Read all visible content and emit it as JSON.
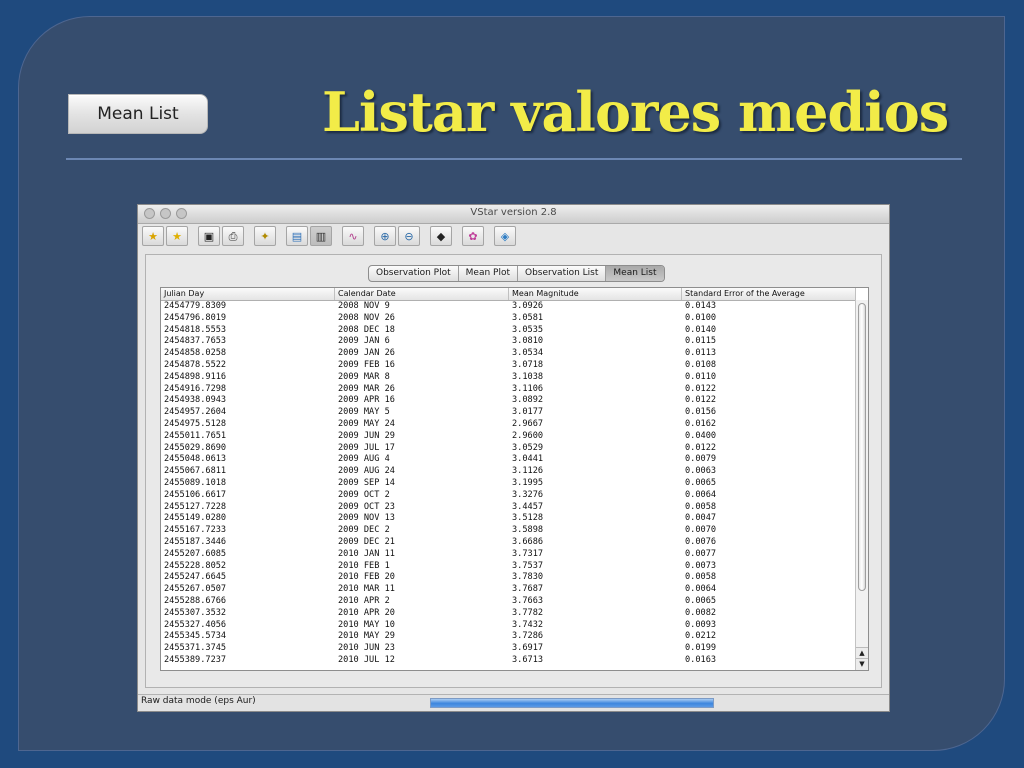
{
  "slide": {
    "button_label": "Mean List",
    "title": "Listar valores medios"
  },
  "window": {
    "title": "VStar version 2.8",
    "toolbar_icons": [
      "new-star-file-icon",
      "new-star-db-icon",
      "save-icon",
      "print-icon",
      "info-icon",
      "plot-icon",
      "mean-plot-icon",
      "phase-plot-icon",
      "zoom-in-icon",
      "zoom-out-icon",
      "filter-icon",
      "model-icon",
      "help-icon"
    ],
    "tabs": [
      "Observation Plot",
      "Mean Plot",
      "Observation List",
      "Mean List"
    ],
    "selected_tab": "Mean List",
    "columns": [
      "Julian Day",
      "Calendar Date",
      "Mean Magnitude",
      "Standard Error of the Average"
    ],
    "rows": [
      [
        "2454779.8309",
        "2008 NOV 9",
        "3.0926",
        "0.0143"
      ],
      [
        "2454796.8019",
        "2008 NOV 26",
        "3.0581",
        "0.0100"
      ],
      [
        "2454818.5553",
        "2008 DEC 18",
        "3.0535",
        "0.0140"
      ],
      [
        "2454837.7653",
        "2009 JAN 6",
        "3.0810",
        "0.0115"
      ],
      [
        "2454858.0258",
        "2009 JAN 26",
        "3.0534",
        "0.0113"
      ],
      [
        "2454878.5522",
        "2009 FEB 16",
        "3.0718",
        "0.0108"
      ],
      [
        "2454898.9116",
        "2009 MAR 8",
        "3.1038",
        "0.0110"
      ],
      [
        "2454916.7298",
        "2009 MAR 26",
        "3.1106",
        "0.0122"
      ],
      [
        "2454938.0943",
        "2009 APR 16",
        "3.0892",
        "0.0122"
      ],
      [
        "2454957.2604",
        "2009 MAY 5",
        "3.0177",
        "0.0156"
      ],
      [
        "2454975.5128",
        "2009 MAY 24",
        "2.9667",
        "0.0162"
      ],
      [
        "2455011.7651",
        "2009 JUN 29",
        "2.9600",
        "0.0400"
      ],
      [
        "2455029.8690",
        "2009 JUL 17",
        "3.0529",
        "0.0122"
      ],
      [
        "2455048.0613",
        "2009 AUG 4",
        "3.0441",
        "0.0079"
      ],
      [
        "2455067.6811",
        "2009 AUG 24",
        "3.1126",
        "0.0063"
      ],
      [
        "2455089.1018",
        "2009 SEP 14",
        "3.1995",
        "0.0065"
      ],
      [
        "2455106.6617",
        "2009 OCT 2",
        "3.3276",
        "0.0064"
      ],
      [
        "2455127.7228",
        "2009 OCT 23",
        "3.4457",
        "0.0058"
      ],
      [
        "2455149.0280",
        "2009 NOV 13",
        "3.5128",
        "0.0047"
      ],
      [
        "2455167.7233",
        "2009 DEC 2",
        "3.5898",
        "0.0070"
      ],
      [
        "2455187.3446",
        "2009 DEC 21",
        "3.6686",
        "0.0076"
      ],
      [
        "2455207.6085",
        "2010 JAN 11",
        "3.7317",
        "0.0077"
      ],
      [
        "2455228.8052",
        "2010 FEB 1",
        "3.7537",
        "0.0073"
      ],
      [
        "2455247.6645",
        "2010 FEB 20",
        "3.7830",
        "0.0058"
      ],
      [
        "2455267.0507",
        "2010 MAR 11",
        "3.7687",
        "0.0064"
      ],
      [
        "2455288.6766",
        "2010 APR 2",
        "3.7663",
        "0.0065"
      ],
      [
        "2455307.3532",
        "2010 APR 20",
        "3.7782",
        "0.0082"
      ],
      [
        "2455327.4056",
        "2010 MAY 10",
        "3.7432",
        "0.0093"
      ],
      [
        "2455345.5734",
        "2010 MAY 29",
        "3.7286",
        "0.0212"
      ],
      [
        "2455371.3745",
        "2010 JUN 23",
        "3.6917",
        "0.0199"
      ],
      [
        "2455389.7237",
        "2010 JUL 12",
        "3.6713",
        "0.0163"
      ]
    ],
    "status_text": "Raw data mode (eps Aur)",
    "progress": 1.0
  }
}
